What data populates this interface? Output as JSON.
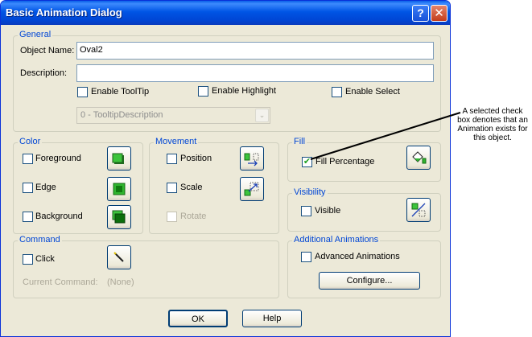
{
  "window": {
    "title": "Basic Animation Dialog",
    "help_glyph": "?",
    "close_glyph": "✕"
  },
  "general": {
    "legend": "General",
    "object_name_label": "Object Name:",
    "object_name_value": "Oval2",
    "description_label": "Description:",
    "description_value": "",
    "enable_tooltip": "Enable ToolTip",
    "enable_highlight": "Enable Highlight",
    "enable_select": "Enable Select",
    "tooltip_combo": "0 - TooltipDescription",
    "combo_arrow": "⌄"
  },
  "color": {
    "legend": "Color",
    "foreground": "Foreground",
    "edge": "Edge",
    "background": "Background"
  },
  "movement": {
    "legend": "Movement",
    "position": "Position",
    "scale": "Scale",
    "rotate": "Rotate"
  },
  "fill": {
    "legend": "Fill",
    "fill_percentage": "Fill Percentage",
    "fill_checked": "✔"
  },
  "visibility": {
    "legend": "Visibility",
    "visible": "Visible"
  },
  "command": {
    "legend": "Command",
    "click": "Click",
    "current_command_label": "Current Command:",
    "current_command_value": "(None)"
  },
  "additional": {
    "legend": "Additional Animations",
    "advanced": "Advanced Animations",
    "configure": "Configure..."
  },
  "buttons": {
    "ok": "OK",
    "help": "Help"
  },
  "callout": {
    "text": "A selected check box denotes that an Animation exists for this object."
  },
  "icons": {
    "foreground": "foreground-color-icon",
    "edge": "edge-color-icon",
    "background": "background-color-icon",
    "position": "position-icon",
    "scale": "scale-icon",
    "fill": "fill-bucket-icon",
    "visible": "visibility-icon",
    "click": "command-wand-icon"
  },
  "colors": {
    "accent": "#0046d5",
    "group_border": "#d0d0bf",
    "face": "#ece9d8",
    "icon_green": "#2fb52f"
  }
}
